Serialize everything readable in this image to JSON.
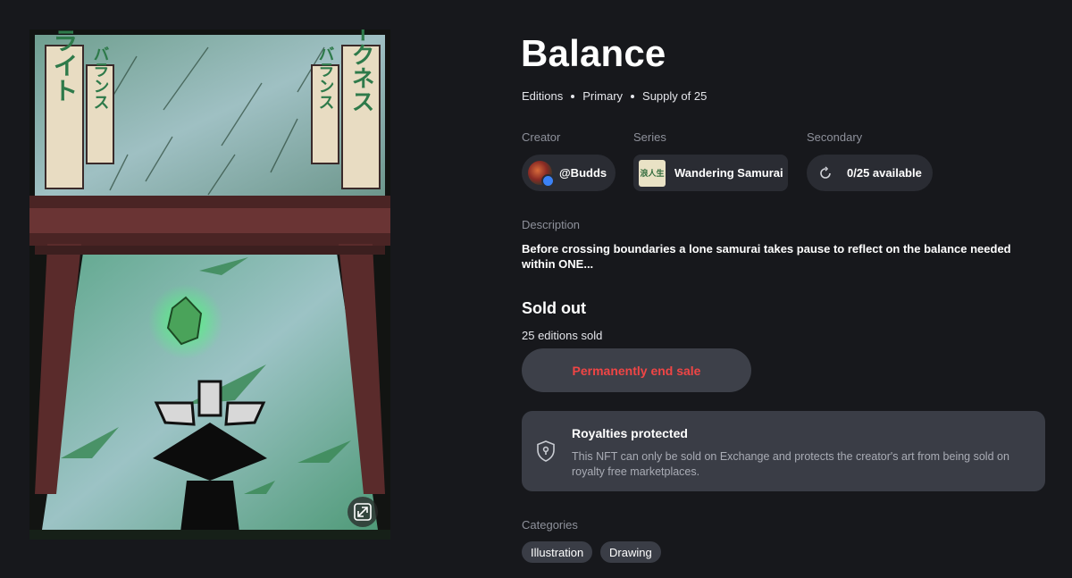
{
  "title": "Balance",
  "meta": [
    "Editions",
    "Primary",
    "Supply of 25"
  ],
  "artwork": {
    "banner_left_outer": "ライト",
    "banner_left_inner": "バランス",
    "banner_right_inner": "バランス",
    "banner_right_outer": "ダークネス"
  },
  "info": {
    "creator_label": "Creator",
    "creator_name": "@Budds",
    "series_label": "Series",
    "series_name": "Wandering Samurai",
    "series_thumb_text": "浪人生",
    "secondary_label": "Secondary",
    "secondary_value": "0/25 available"
  },
  "description": {
    "label": "Description",
    "text": "Before crossing boundaries a lone samurai takes pause to reflect on the balance needed within ONE..."
  },
  "sale": {
    "status": "Sold out",
    "sold_count": "25 editions sold",
    "end_button": "Permanently end sale"
  },
  "royalties": {
    "title": "Royalties protected",
    "text": "This NFT can only be sold on Exchange and protects the creator's art from being sold on royalty free marketplaces."
  },
  "categories": {
    "label": "Categories",
    "items": [
      "Illustration",
      "Drawing"
    ]
  },
  "colors": {
    "background": "#17181c",
    "pill": "#2a2c33",
    "danger": "#f04545",
    "card": "#3a3d46"
  }
}
